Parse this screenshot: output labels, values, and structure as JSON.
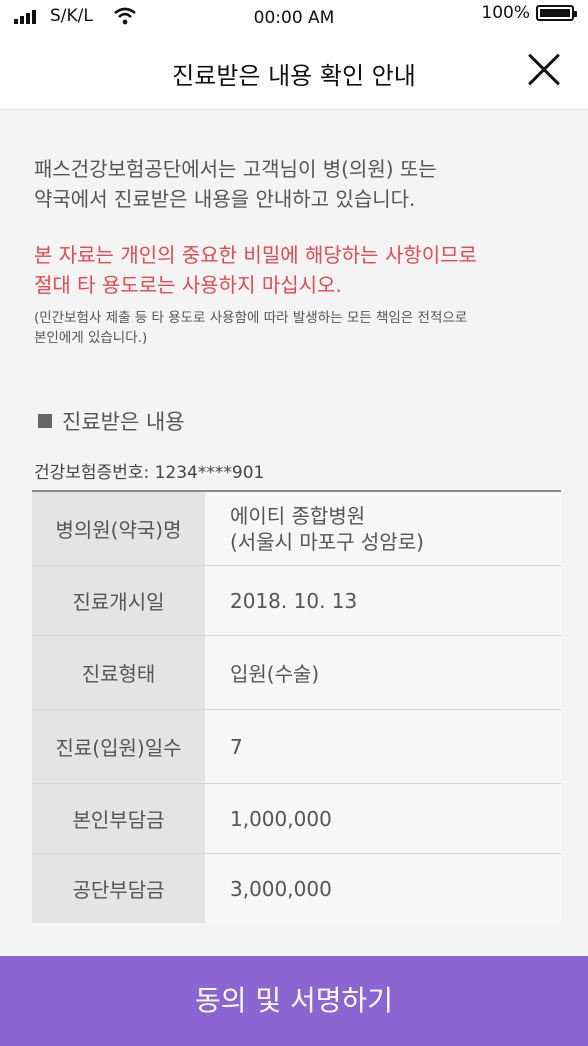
{
  "status_bar": {
    "carrier": "S/K/L",
    "time": "00:00 AM",
    "battery": "100%"
  },
  "header": {
    "title": "진료받은 내용 확인 안내"
  },
  "intro": {
    "line1": "패스건강보험공단에서는 고객님이 병(의원) 또는",
    "line2": "약국에서 진료받은 내용을 안내하고 있습니다."
  },
  "warning": {
    "line1": "본 자료는 개인의 중요한 비밀에 해당하는 사항이므로",
    "line2": "절대 타 용도로는 사용하지 마십시오."
  },
  "notice": {
    "line1": "(민간보험사 제출 등 타 용도로 사용함에 따라 발생하는 모든 책임은 전적으로",
    "line2": "본인에게 있습니다.)"
  },
  "section": {
    "title": "진료받은 내용"
  },
  "insurance": {
    "label": "건강보험증번호: 1234****901"
  },
  "details": [
    {
      "key": "병의원(약국)명",
      "value_line1": "에이티 종합병원",
      "value_line2": "(서울시 마포구 성암로)"
    },
    {
      "key": "진료개시일",
      "value_line1": "2018. 10. 13"
    },
    {
      "key": "진료형태",
      "value_line1": "입원(수술)"
    },
    {
      "key": "진료(입원)일수",
      "value_line1": "7"
    },
    {
      "key": "본인부담금",
      "value_line1": "1,000,000"
    },
    {
      "key": "공단부담금",
      "value_line1": "3,000,000"
    }
  ],
  "footer": {
    "button_label": "동의 및 서명하기"
  },
  "colors": {
    "accent": "#8b66d2",
    "warning": "#e8494c"
  }
}
